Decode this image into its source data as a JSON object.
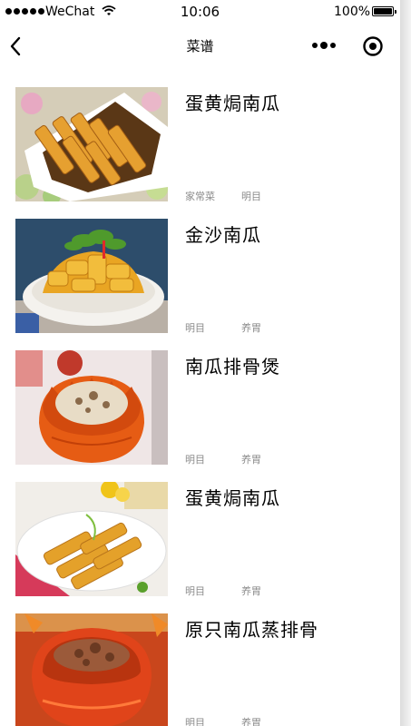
{
  "status_bar": {
    "carrier": "WeChat",
    "time": "10:06",
    "battery_percent": "100%",
    "battery_level": 1.0
  },
  "nav": {
    "title": "菜谱",
    "back_icon": "chevron-left-icon",
    "more_icon": "more-dots-icon",
    "close_icon": "target-circle-icon"
  },
  "recipes": [
    {
      "title": "蛋黄焗南瓜",
      "tags": [
        "家常菜",
        "明目"
      ]
    },
    {
      "title": "金沙南瓜",
      "tags": [
        "明目",
        "养胃"
      ]
    },
    {
      "title": "南瓜排骨煲",
      "tags": [
        "明目",
        "养胃"
      ]
    },
    {
      "title": "蛋黄焗南瓜",
      "tags": [
        "明目",
        "养胃"
      ]
    },
    {
      "title": "原只南瓜蒸排骨",
      "tags": [
        "明目",
        "养胃"
      ]
    }
  ],
  "colors": {
    "tag_text": "#8b8b8b",
    "background": "#ffffff"
  }
}
